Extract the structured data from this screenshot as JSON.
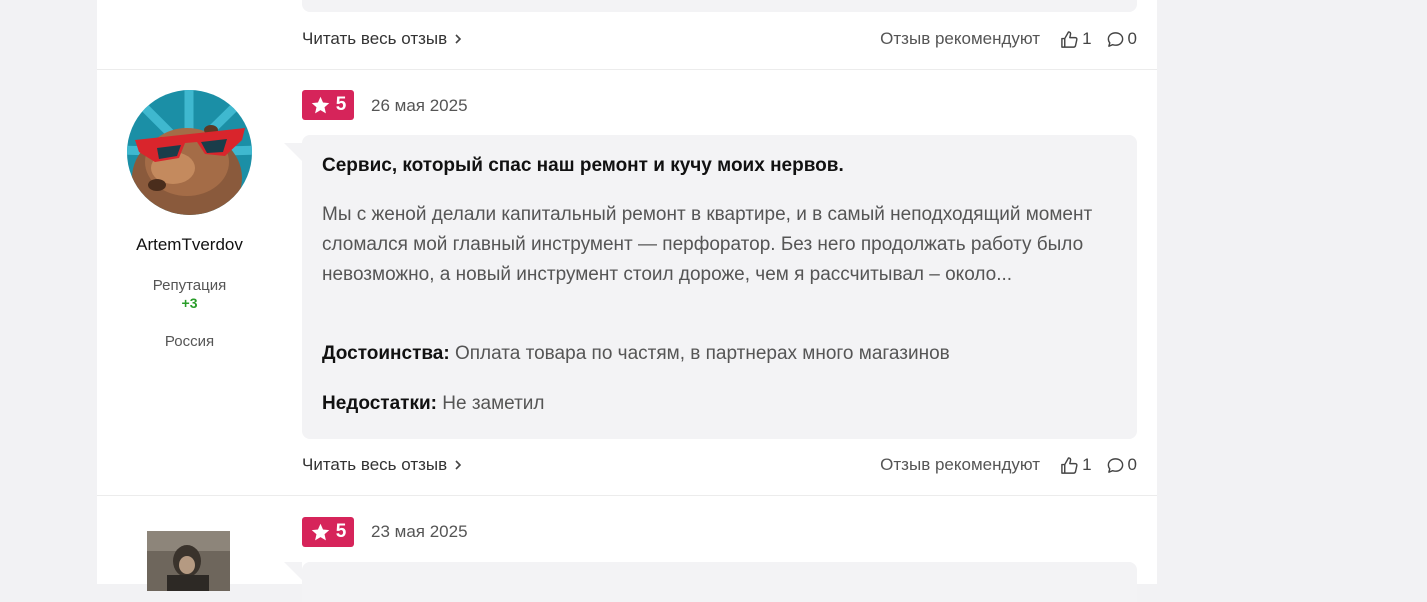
{
  "colors": {
    "accent": "#d6245a",
    "reputation_positive": "#2a9d2a",
    "card_bg": "#f3f3f5"
  },
  "prev_review": {
    "read_more": "Читать весь отзыв",
    "recommend_label": "Отзыв рекомендуют",
    "likes": "1",
    "comments": "0"
  },
  "review": {
    "rating": "5",
    "date": "26 мая 2025",
    "author": {
      "username": "ArtemTverdov",
      "reputation_label": "Репутация",
      "reputation_value": "+3",
      "country": "Россия"
    },
    "title": "Сервис, который спас наш ремонт и кучу моих нервов.",
    "body": "Мы с женой делали капитальный ремонт в квартире, и в самый неподходящий момент сломался мой главный инструмент — перфоратор. Без него продолжать работу было невозможно, а новый инструмент стоил дороже, чем я рассчитывал – около...",
    "pros_label": "Достоинства:",
    "pros": "Оплата товара по частям, в партнерах много магазинов",
    "cons_label": "Недостатки:",
    "cons": "Не заметил",
    "read_more": "Читать весь отзыв",
    "recommend_label": "Отзыв рекомендуют",
    "likes": "1",
    "comments": "0"
  },
  "next_review": {
    "rating": "5",
    "date": "23 мая 2025"
  },
  "icons": {
    "star": "star-icon",
    "like": "thumbs-up-icon",
    "comment": "comment-bubble-icon",
    "chevron": "chevron-right-icon"
  }
}
